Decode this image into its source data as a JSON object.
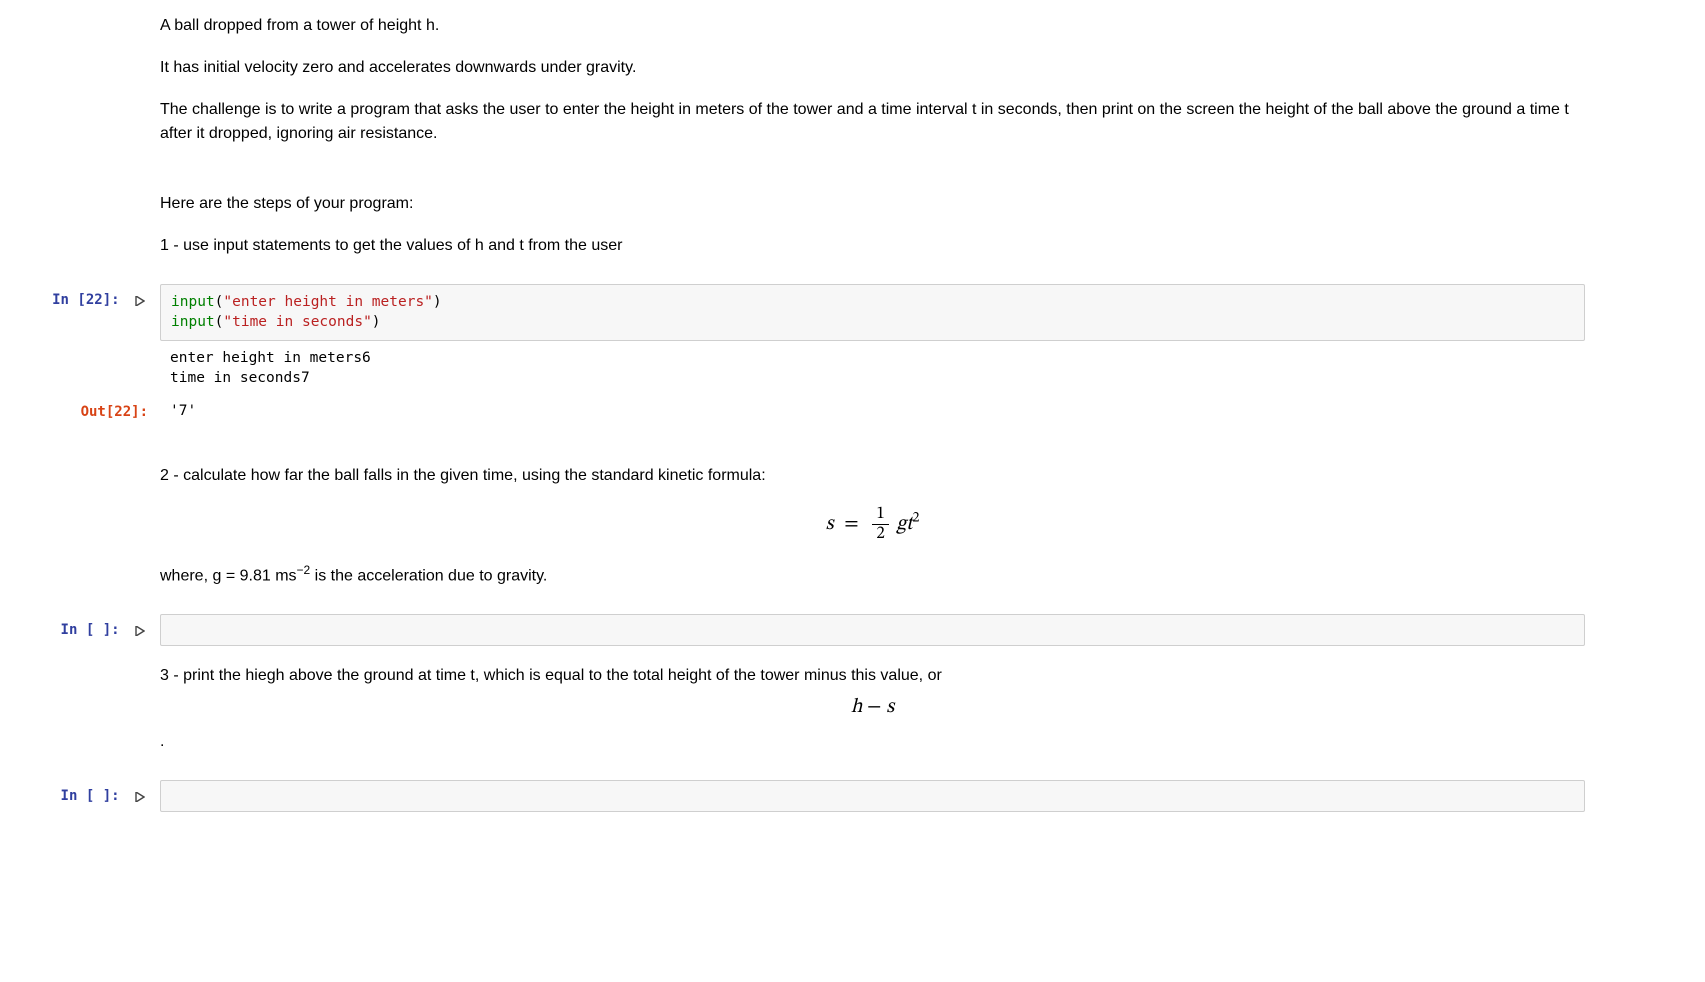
{
  "markdown": {
    "p1": "A ball dropped from a tower of height h.",
    "p2": "It has initial velocity zero and accelerates downwards under gravity.",
    "p3": "The challenge is to write a program that asks the user to enter the height in meters of the tower and a time interval t in seconds, then print on the screen the height of the ball above the ground a time t after it dropped, ignoring air resistance.",
    "steps_intro": "Here are the steps of your program:",
    "step1": "1 - use input statements to get the values of h and t from the user",
    "step2": "2 - calculate how far the ball falls in the given time, using the standard kinetic formula:",
    "formula1_lhs_s": "s",
    "formula1_eq": "=",
    "formula1_frac_num": "1",
    "formula1_frac_den": "2",
    "formula1_g": "g",
    "formula1_t": "t",
    "formula1_exp": "2",
    "step2b_pre": "where, g = 9.81 ms",
    "step2b_exp": "−2",
    "step2b_post": " is the acceleration due to gravity.",
    "step3": "3 - print the hiegh above the ground at time t, which is equal to the total height of the tower minus this value, or",
    "formula2_h": "h",
    "formula2_minus": " − ",
    "formula2_s": "s",
    "step3_dot": "."
  },
  "cells": {
    "c1": {
      "prompt": "In [22]:",
      "code": {
        "builtin1": "input",
        "paren_o1": "(",
        "str1": "\"enter height in meters\"",
        "paren_c1": ")",
        "newline": "\n",
        "builtin2": "input",
        "paren_o2": "(",
        "str2": "\"time in seconds\"",
        "paren_c2": ")"
      },
      "stdout": "enter height in meters6\ntime in seconds7",
      "out_prompt": "Out[22]:",
      "result": "'7'"
    },
    "c2": {
      "prompt": "In [ ]:"
    },
    "c3": {
      "prompt": "In [ ]:"
    }
  }
}
